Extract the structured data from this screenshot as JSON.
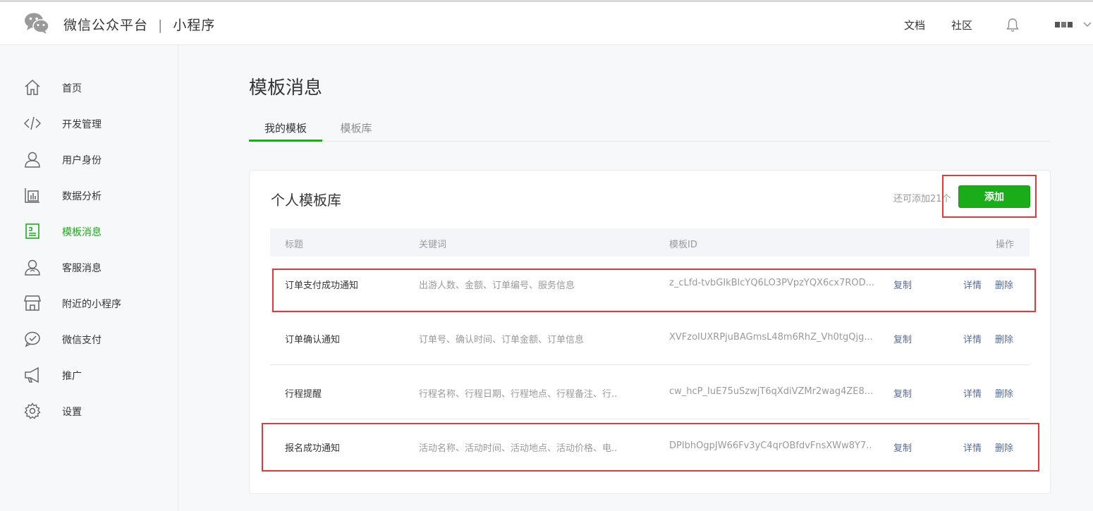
{
  "header": {
    "brand_name": "微信公众平台",
    "separator": "|",
    "product_name": "小程序",
    "links": [
      "文档",
      "社区"
    ],
    "icons": [
      "wechat-logo-icon",
      "bell-icon",
      "avatar",
      "chevron-down-icon"
    ]
  },
  "sidebar": {
    "items": [
      {
        "label": "首页",
        "icon": "home-icon"
      },
      {
        "label": "开发管理",
        "icon": "code-icon"
      },
      {
        "label": "用户身份",
        "icon": "user-icon"
      },
      {
        "label": "数据分析",
        "icon": "bar-chart-icon"
      },
      {
        "label": "模板消息",
        "icon": "template-doc-icon",
        "active": true
      },
      {
        "label": "客服消息",
        "icon": "customer-service-icon"
      },
      {
        "label": "附近的小程序",
        "icon": "store-icon"
      },
      {
        "label": "微信支付",
        "icon": "wechat-pay-icon"
      },
      {
        "label": "推广",
        "icon": "megaphone-icon"
      },
      {
        "label": "设置",
        "icon": "gear-icon"
      }
    ]
  },
  "main": {
    "title": "模板消息",
    "tabs": [
      {
        "label": "我的模板",
        "active": true
      },
      {
        "label": "模板库",
        "active": false
      }
    ],
    "card": {
      "title": "个人模板库",
      "remaining_text": "还可添加21个",
      "add_button": "添加",
      "columns": [
        "标题",
        "关键词",
        "模板ID",
        "操作"
      ],
      "rows": [
        {
          "title": "订单支付成功通知",
          "keywords": "出游人数、金额、订单编号、服务信息",
          "template_id": "z_cLfd-tvbGIkBlcYQ6LO3PVpzYQX6cx7ROD...",
          "copy": "复制",
          "detail": "详情",
          "delete": "删除"
        },
        {
          "title": "订单确认通知",
          "keywords": "订单号、确认时间、订单金额、订单信息",
          "template_id": "XVFzoIUXRPjuBAGmsL48m6RhZ_Vh0tgQjg...",
          "copy": "复制",
          "detail": "详情",
          "delete": "删除"
        },
        {
          "title": "行程提醒",
          "keywords": "行程名称、行程日期、行程地点、行程备注、行..",
          "template_id": "cw_hcP_IuE75uSzwjT6qXdiVZMr2wag4ZE8...",
          "copy": "复制",
          "detail": "详情",
          "delete": "删除"
        },
        {
          "title": "报名成功通知",
          "keywords": "活动名称、活动时间、活动地点、活动价格、电..",
          "template_id": "DPIbhOgpJW66Fv3yC4qrOBfdvFnsXWw8Y7..",
          "copy": "复制",
          "detail": "详情",
          "delete": "删除"
        }
      ]
    }
  },
  "colors": {
    "accent_green": "#1aad19",
    "link_blue": "#576b95",
    "annotation_red": "#e5383b"
  }
}
